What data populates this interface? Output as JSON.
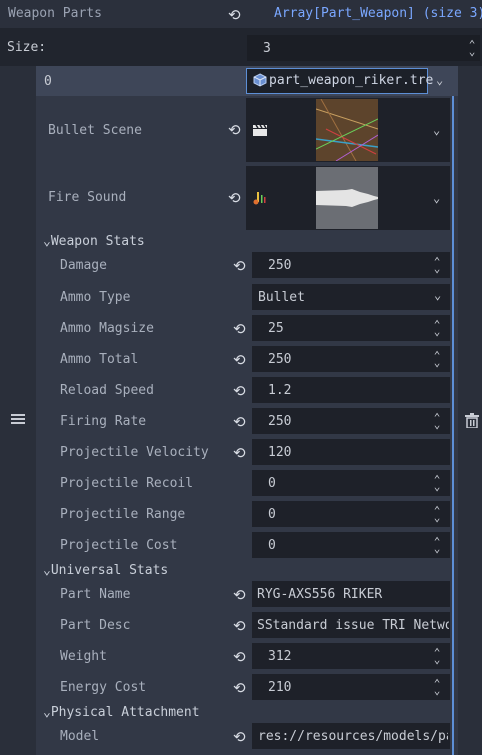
{
  "header": {
    "property": "Weapon Parts",
    "value": "Array[Part_Weapon] (size 3)"
  },
  "size_row": {
    "label": "Size:",
    "value": "3"
  },
  "element": {
    "index": "0",
    "resource": "part_weapon_riker.tre"
  },
  "bullet_scene": {
    "label": "Bullet Scene"
  },
  "fire_sound": {
    "label": "Fire Sound"
  },
  "sections": {
    "weapon_stats": "Weapon Stats",
    "universal_stats": "Universal Stats",
    "physical_attachment": "Physical Attachment"
  },
  "weapon_stats": {
    "damage": {
      "label": "Damage",
      "value": "250"
    },
    "ammo_type": {
      "label": "Ammo Type",
      "value": "Bullet"
    },
    "ammo_magsize": {
      "label": "Ammo Magsize",
      "value": "25"
    },
    "ammo_total": {
      "label": "Ammo Total",
      "value": "250"
    },
    "reload_speed": {
      "label": "Reload Speed",
      "value": "1.2"
    },
    "firing_rate": {
      "label": "Firing Rate",
      "value": "250"
    },
    "projectile_velocity": {
      "label": "Projectile Velocity",
      "value": "120"
    },
    "projectile_recoil": {
      "label": "Projectile Recoil",
      "value": "0"
    },
    "projectile_range": {
      "label": "Projectile Range",
      "value": "0"
    },
    "projectile_cost": {
      "label": "Projectile Cost",
      "value": "0"
    }
  },
  "universal_stats": {
    "part_name": {
      "label": "Part Name",
      "value": "RYG-AXS556 RIKER"
    },
    "part_desc": {
      "label": "Part Desc",
      "value": "SStandard issue TRI Networ"
    },
    "weight": {
      "label": "Weight",
      "value": "312"
    },
    "energy_cost": {
      "label": "Energy Cost",
      "value": "210"
    }
  },
  "physical_attachment": {
    "model": {
      "label": "Model",
      "value": "res://resources/models/par"
    }
  },
  "icons": {
    "revert": "revert-icon",
    "menu": "hamburger-menu-icon",
    "delete": "trash-icon",
    "resource": "resource-cube-icon",
    "scene": "clapperboard-icon",
    "audio": "audio-stream-icon"
  },
  "colors": {
    "accent": "#5d8fd6",
    "link": "#7aa7ff",
    "field": "#1e2129",
    "panel": "#323846"
  }
}
